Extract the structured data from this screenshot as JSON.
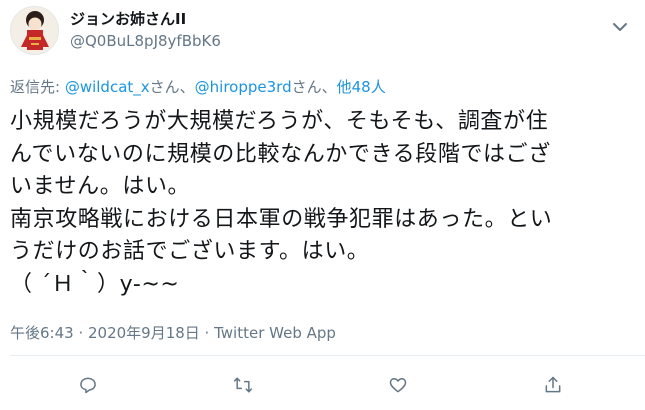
{
  "tweet": {
    "author": {
      "display_name": "ジョンお姉さんII",
      "handle": "@Q0BuL8pJ8yfBbK6",
      "avatar": "avatar-illustration"
    },
    "reply_to": {
      "prefix": "返信先: ",
      "user1": "@wildcat_x",
      "san1": "さん、",
      "user2": "@hiroppe3rd",
      "san2": "さん、",
      "others": "他48人"
    },
    "text_lines": [
      "小規模だろうが大規模だろうが、そもそも、調査が住",
      "んでいないのに規模の比較なんかできる段階ではござ",
      "いません。はい。",
      "南京攻略戦における日本軍の戦争犯罪はあった。とい",
      "うだけのお話でございます。はい。",
      "（ ´Ｈ｀）y-~~"
    ],
    "timestamp": "午後6:43 · 2020年9月18日 · Twitter Web App"
  },
  "actions": {
    "reply_icon": "reply-icon",
    "retweet_icon": "retweet-icon",
    "like_icon": "like-icon",
    "share_icon": "share-icon"
  },
  "colors": {
    "text": "#14171a",
    "secondary": "#657786",
    "link": "#1b95e0",
    "divider": "#e6ecf0"
  }
}
